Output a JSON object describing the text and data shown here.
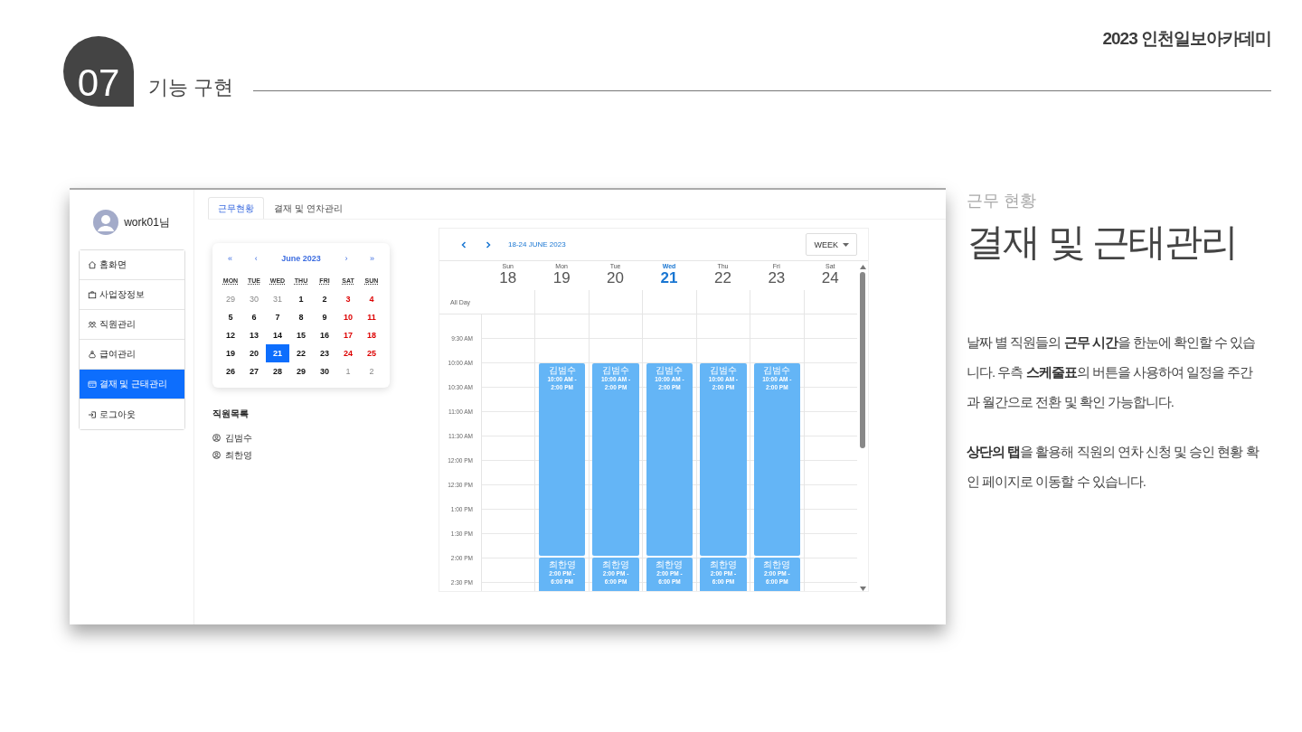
{
  "brand": "2023 인천일보아카데미",
  "section": {
    "number": "07",
    "title": "기능 구현"
  },
  "app": {
    "user": {
      "name": "work01님"
    },
    "menu": [
      {
        "label": "홈화면",
        "selected": false
      },
      {
        "label": "사업장정보",
        "selected": false
      },
      {
        "label": "직원관리",
        "selected": false
      },
      {
        "label": "급여관리",
        "selected": false
      },
      {
        "label": "결재 및 근태관리",
        "selected": true
      },
      {
        "label": "로그아웃",
        "selected": false
      }
    ],
    "tabs": [
      {
        "label": "근무현황",
        "selected": true
      },
      {
        "label": "결재 및 연차관리",
        "selected": false
      }
    ],
    "mini_calendar": {
      "nav": [
        "«",
        "‹",
        "›",
        "»"
      ],
      "month": "June 2023",
      "weekdays": [
        "MON",
        "TUE",
        "WED",
        "THU",
        "FRI",
        "SAT",
        "SUN"
      ],
      "days": [
        {
          "day": "29",
          "kind": "other",
          "selected": false
        },
        {
          "day": "30",
          "kind": "other",
          "selected": false
        },
        {
          "day": "31",
          "kind": "other",
          "selected": false
        },
        {
          "day": "1",
          "kind": "weekday",
          "selected": false
        },
        {
          "day": "2",
          "kind": "weekday",
          "selected": false
        },
        {
          "day": "3",
          "kind": "weekend",
          "selected": false
        },
        {
          "day": "4",
          "kind": "weekend",
          "selected": false
        },
        {
          "day": "5",
          "kind": "weekday",
          "selected": false
        },
        {
          "day": "6",
          "kind": "weekday",
          "selected": false
        },
        {
          "day": "7",
          "kind": "weekday",
          "selected": false
        },
        {
          "day": "8",
          "kind": "weekday",
          "selected": false
        },
        {
          "day": "9",
          "kind": "weekday",
          "selected": false
        },
        {
          "day": "10",
          "kind": "weekend",
          "selected": false
        },
        {
          "day": "11",
          "kind": "weekend",
          "selected": false
        },
        {
          "day": "12",
          "kind": "weekday",
          "selected": false
        },
        {
          "day": "13",
          "kind": "weekday",
          "selected": false
        },
        {
          "day": "14",
          "kind": "weekday",
          "selected": false
        },
        {
          "day": "15",
          "kind": "weekday",
          "selected": false
        },
        {
          "day": "16",
          "kind": "weekday",
          "selected": false
        },
        {
          "day": "17",
          "kind": "weekend",
          "selected": false
        },
        {
          "day": "18",
          "kind": "weekend",
          "selected": false
        },
        {
          "day": "19",
          "kind": "weekday",
          "selected": false
        },
        {
          "day": "20",
          "kind": "weekday",
          "selected": false
        },
        {
          "day": "21",
          "kind": "weekday",
          "selected": true
        },
        {
          "day": "22",
          "kind": "weekday",
          "selected": false
        },
        {
          "day": "23",
          "kind": "weekday",
          "selected": false
        },
        {
          "day": "24",
          "kind": "weekend",
          "selected": false
        },
        {
          "day": "25",
          "kind": "weekend",
          "selected": false
        },
        {
          "day": "26",
          "kind": "weekday",
          "selected": false
        },
        {
          "day": "27",
          "kind": "weekday",
          "selected": false
        },
        {
          "day": "28",
          "kind": "weekday",
          "selected": false
        },
        {
          "day": "29",
          "kind": "weekday",
          "selected": false
        },
        {
          "day": "30",
          "kind": "weekday",
          "selected": false
        },
        {
          "day": "1",
          "kind": "other",
          "selected": false
        },
        {
          "day": "2",
          "kind": "other",
          "selected": false
        }
      ]
    },
    "employees": {
      "title": "직원목록",
      "items": [
        "김범수",
        "최한영"
      ]
    },
    "scheduler": {
      "range": "18-24 JUNE 2023",
      "view": "WEEK",
      "all_day": "All Day",
      "days": [
        {
          "name": "Sun",
          "date": "18",
          "today": false
        },
        {
          "name": "Mon",
          "date": "19",
          "today": false,
          "events": [
            {
              "name": "김범수",
              "time": "10:00 AM - 2:00 PM"
            },
            {
              "name": "최한영",
              "time": "2:00 PM - 6:00 PM"
            }
          ]
        },
        {
          "name": "Tue",
          "date": "20",
          "today": false,
          "events": [
            {
              "name": "김범수",
              "time": "10:00 AM - 2:00 PM"
            },
            {
              "name": "최한영",
              "time": "2:00 PM - 6:00 PM"
            }
          ]
        },
        {
          "name": "Wed",
          "date": "21",
          "today": true,
          "events": [
            {
              "name": "김범수",
              "time": "10:00 AM - 2:00 PM"
            },
            {
              "name": "최한영",
              "time": "2:00 PM - 6:00 PM"
            }
          ]
        },
        {
          "name": "Thu",
          "date": "22",
          "today": false,
          "events": [
            {
              "name": "김범수",
              "time": "10:00 AM - 2:00 PM"
            },
            {
              "name": "최한영",
              "time": "2:00 PM - 6:00 PM"
            }
          ]
        },
        {
          "name": "Fri",
          "date": "23",
          "today": false,
          "events": [
            {
              "name": "김범수",
              "time": "10:00 AM - 2:00 PM"
            },
            {
              "name": "최한영",
              "time": "2:00 PM - 6:00 PM"
            }
          ]
        },
        {
          "name": "Sat",
          "date": "24",
          "today": false
        }
      ],
      "times": [
        "9:30 AM",
        "10:00 AM",
        "10:30 AM",
        "11:00 AM",
        "11:30 AM",
        "12:00 PM",
        "12:30 PM",
        "1:00 PM",
        "1:30 PM",
        "2:00 PM",
        "2:30 PM"
      ]
    }
  },
  "description": {
    "eyebrow": "근무 현황",
    "title": "결재 및 근태관리",
    "paragraphs": [
      "날짜 별 직원들의 **근무 시간**을 한눈에 확인할 수 있습니다. 우측 **스케줄표**의 버튼을 사용하여 일정을 주간과 월간으로 전환 및 확인 가능합니다.",
      "**상단의 탭**을 활용해 직원의 연차 신청 및 승인 현황 확인 페이지로 이동할 수 있습니다."
    ]
  }
}
